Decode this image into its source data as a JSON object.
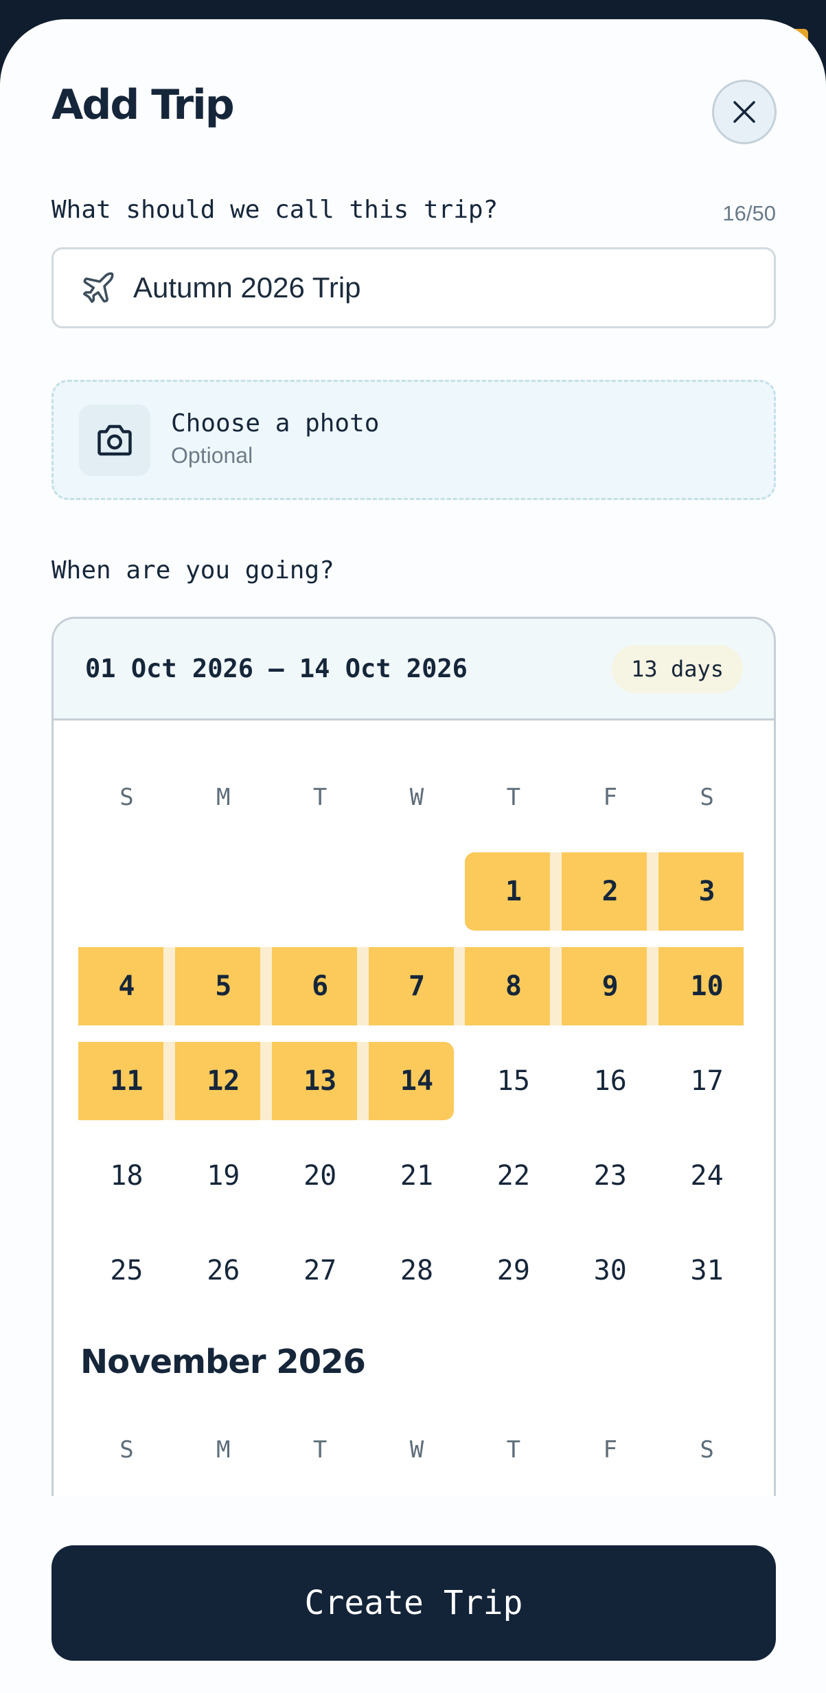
{
  "header": {
    "title": "Add Trip"
  },
  "name_field": {
    "label": "What should we call this trip?",
    "counter": "16/50",
    "value": "Autumn 2026 Trip"
  },
  "photo": {
    "title": "Choose a photo",
    "subtitle": "Optional"
  },
  "dates": {
    "label": "When are you going?",
    "range": "01 Oct 2026 – 14 Oct 2026",
    "duration": "13 days"
  },
  "calendar": {
    "weekdays": [
      "S",
      "M",
      "T",
      "W",
      "T",
      "F",
      "S"
    ],
    "october_weeks": [
      [
        null,
        null,
        null,
        null,
        "1",
        "2",
        "3"
      ],
      [
        "4",
        "5",
        "6",
        "7",
        "8",
        "9",
        "10"
      ],
      [
        "11",
        "12",
        "13",
        "14",
        "15",
        "16",
        "17"
      ],
      [
        "18",
        "19",
        "20",
        "21",
        "22",
        "23",
        "24"
      ],
      [
        "25",
        "26",
        "27",
        "28",
        "29",
        "30",
        "31"
      ]
    ],
    "selected_start": "1",
    "selected_end": "14",
    "next_month_title": "November 2026"
  },
  "footer": {
    "create_label": "Create Trip"
  },
  "colors": {
    "accent": "#fbca5b",
    "primary": "#132338",
    "text": "#16263a"
  },
  "icons": {
    "close": "close-icon",
    "plane": "airplane-icon",
    "camera": "camera-icon"
  }
}
